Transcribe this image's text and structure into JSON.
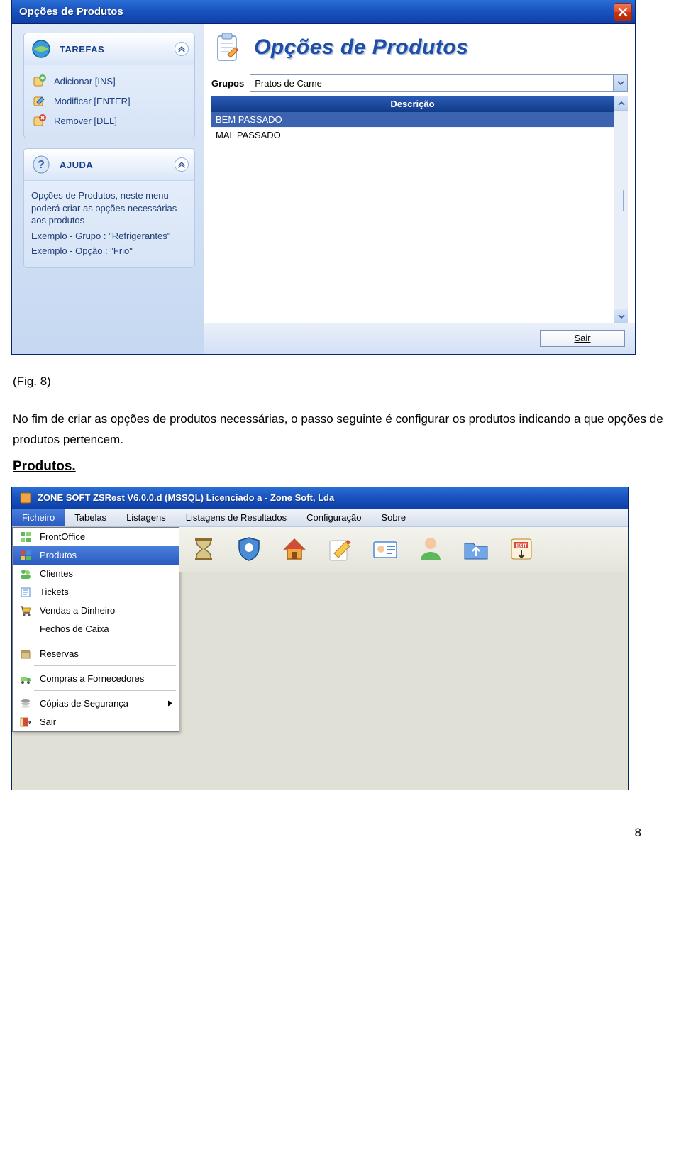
{
  "win1": {
    "title": "Opções de Produtos",
    "tasks_header": "TAREFAS",
    "tasks": [
      {
        "label": "Adicionar [INS]"
      },
      {
        "label": "Modificar [ENTER]"
      },
      {
        "label": "Remover [DEL]"
      }
    ],
    "help_header": "AJUDA",
    "help_lines": [
      "Opções de Produtos, neste menu poderá criar as opções necessárias aos produtos",
      "Exemplo - Grupo : \"Refrigerantes\"",
      "Exemplo - Opção : \"Frio\""
    ],
    "main_title": "Opções de Produtos",
    "grupos_label": "Grupos",
    "grupos_value": "Pratos de Carne",
    "column_header": "Descrição",
    "rows": [
      "BEM PASSADO",
      "MAL PASSADO"
    ],
    "exit_label": "Sair"
  },
  "doc": {
    "fig_caption": "(Fig. 8)",
    "paragraph": "No fim de criar as opções de produtos necessárias, o passo seguinte é configurar os produtos indicando a que opções de produtos pertencem.",
    "heading": "Produtos."
  },
  "win2": {
    "title": "ZONE SOFT ZSRest V6.0.0.d (MSSQL) Licenciado a  - Zone Soft, Lda",
    "menus": [
      "Ficheiro",
      "Tabelas",
      "Listagens",
      "Listagens de Resultados",
      "Configuração",
      "Sobre"
    ],
    "menu_selected_index": 0,
    "dropdown": [
      {
        "label": "FrontOffice",
        "icon": "grid-green"
      },
      {
        "label": "Produtos",
        "icon": "grid-color",
        "selected": true
      },
      {
        "label": "Clientes",
        "icon": "people"
      },
      {
        "label": "Tickets",
        "icon": "lines"
      },
      {
        "label": "Vendas a Dinheiro",
        "icon": "cart"
      },
      {
        "label": "Fechos de Caixa",
        "icon": ""
      },
      {
        "sep": true
      },
      {
        "label": "Reservas",
        "icon": "box"
      },
      {
        "sep": true
      },
      {
        "label": "Compras a Fornecedores",
        "icon": "truck"
      },
      {
        "sep": true
      },
      {
        "label": "Cópias de Segurança",
        "icon": "stack",
        "submenu": true
      },
      {
        "label": "Sair",
        "icon": "exit"
      }
    ],
    "toolbar_icons": [
      "hourglass",
      "shield",
      "house",
      "pencil",
      "idcard",
      "person",
      "folder-up",
      "exit-red"
    ]
  },
  "page_number": "8"
}
